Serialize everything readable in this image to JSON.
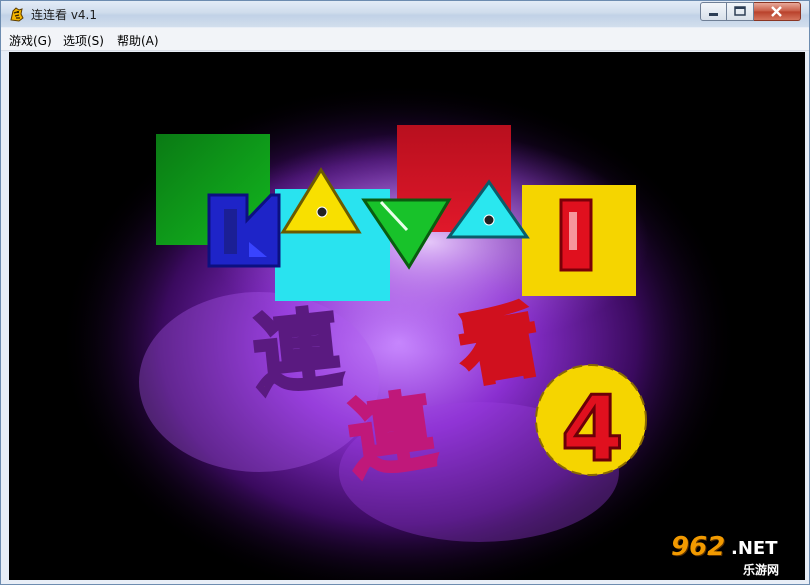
{
  "window": {
    "title": "连连看 v4.1",
    "icons": {
      "app": "tiger-app-icon",
      "minimize": "minimize-icon",
      "maximize": "maximize-icon",
      "close": "close-icon"
    }
  },
  "menu": {
    "game": "游戏(G)",
    "options": "选项(S)",
    "help": "帮助(A)"
  },
  "splash": {
    "logo_letters": [
      "K",
      "A",
      "W",
      "A",
      "I"
    ],
    "chinese_chars": [
      "連",
      "連",
      "看"
    ],
    "version_digit": "4"
  },
  "watermark": {
    "number": "962",
    "domain": ".NET",
    "site_name": "乐游网"
  },
  "colors": {
    "green": "#0f9a1a",
    "cyan": "#29e3ef",
    "red": "#d41020",
    "yellow": "#f5d500",
    "blue": "#1e24c8",
    "purple_glow": "#7a1fb5"
  }
}
